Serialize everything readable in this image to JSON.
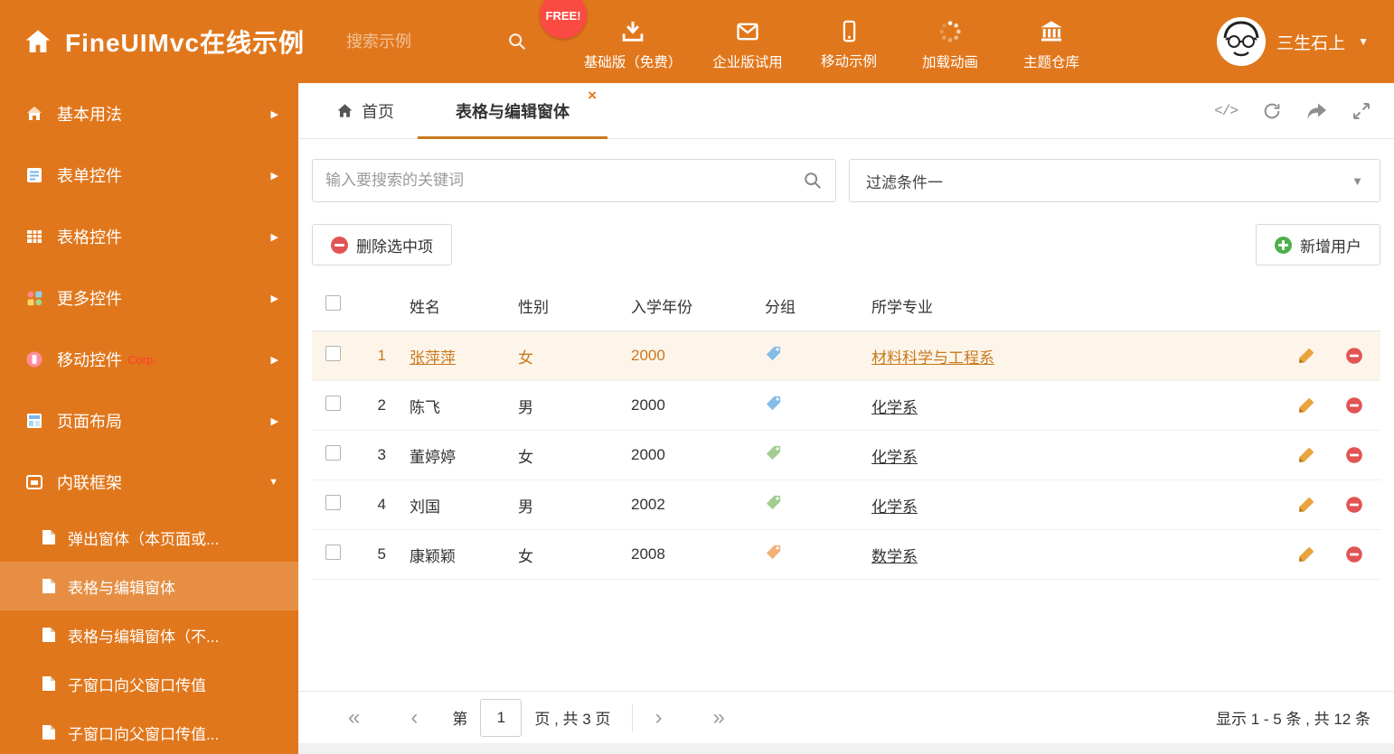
{
  "header": {
    "app_title": "FineUIMvc在线示例",
    "search_placeholder": "搜索示例",
    "free_badge": "FREE!",
    "nav": [
      {
        "label": "基础版（免费）"
      },
      {
        "label": "企业版试用"
      },
      {
        "label": "移动示例"
      },
      {
        "label": "加载动画"
      },
      {
        "label": "主题仓库"
      }
    ],
    "user_name": "三生石上"
  },
  "sidebar": {
    "items": [
      {
        "label": "基本用法"
      },
      {
        "label": "表单控件"
      },
      {
        "label": "表格控件"
      },
      {
        "label": "更多控件"
      },
      {
        "label": "移动控件",
        "badge": "Corp."
      },
      {
        "label": "页面布局"
      },
      {
        "label": "内联框架",
        "expanded": true
      }
    ],
    "subitems": [
      {
        "label": "弹出窗体（本页面或...",
        "active": false
      },
      {
        "label": "表格与编辑窗体",
        "active": true
      },
      {
        "label": "表格与编辑窗体（不...",
        "active": false
      },
      {
        "label": "子窗口向父窗口传值",
        "active": false
      },
      {
        "label": "子窗口向父窗口传值...",
        "active": false
      }
    ]
  },
  "tabs": {
    "home": "首页",
    "active": "表格与编辑窗体",
    "close": "×"
  },
  "filter_bar": {
    "search_placeholder": "输入要搜索的关键词",
    "filter_selected": "过滤条件一"
  },
  "toolbar": {
    "delete_selected": "删除选中项",
    "add_user": "新增用户"
  },
  "table": {
    "columns": [
      "姓名",
      "性别",
      "入学年份",
      "分组",
      "所学专业"
    ],
    "rows": [
      {
        "num": "1",
        "name": "张萍萍",
        "gender": "女",
        "year": "2000",
        "tag_color": "blue",
        "major": "材料科学与工程系",
        "selected": true
      },
      {
        "num": "2",
        "name": "陈飞",
        "gender": "男",
        "year": "2000",
        "tag_color": "blue",
        "major": "化学系",
        "selected": false
      },
      {
        "num": "3",
        "name": "董婷婷",
        "gender": "女",
        "year": "2000",
        "tag_color": "green",
        "major": "化学系",
        "selected": false
      },
      {
        "num": "4",
        "name": "刘国",
        "gender": "男",
        "year": "2002",
        "tag_color": "green",
        "major": "化学系",
        "selected": false
      },
      {
        "num": "5",
        "name": "康颖颖",
        "gender": "女",
        "year": "2008",
        "tag_color": "orange",
        "major": "数学系",
        "selected": false
      }
    ]
  },
  "pagination": {
    "first": "«",
    "prev": "‹",
    "page_prefix": "第",
    "current_page": "1",
    "page_suffix": "页 , 共 3 页",
    "next": "›",
    "last": "»",
    "summary": "显示 1 - 5 条 , 共 12 条"
  },
  "icons": {
    "code": "</>",
    "chevron_right": "▶",
    "chevron_down": "▼",
    "caret_down": "▼",
    "select_caret": "▼"
  },
  "colors": {
    "theme_orange": "#e1771c",
    "active_link_orange": "#c8791d",
    "selected_row_bg": "#fdf5ea",
    "free_badge_red": "#fb4a42",
    "delete_red": "#e25454",
    "add_green": "#4db04a",
    "pencil_orange": "#e9a43e",
    "tags": {
      "blue": "#85bce8",
      "green": "#a3cd90",
      "orange": "#f3b077"
    }
  }
}
